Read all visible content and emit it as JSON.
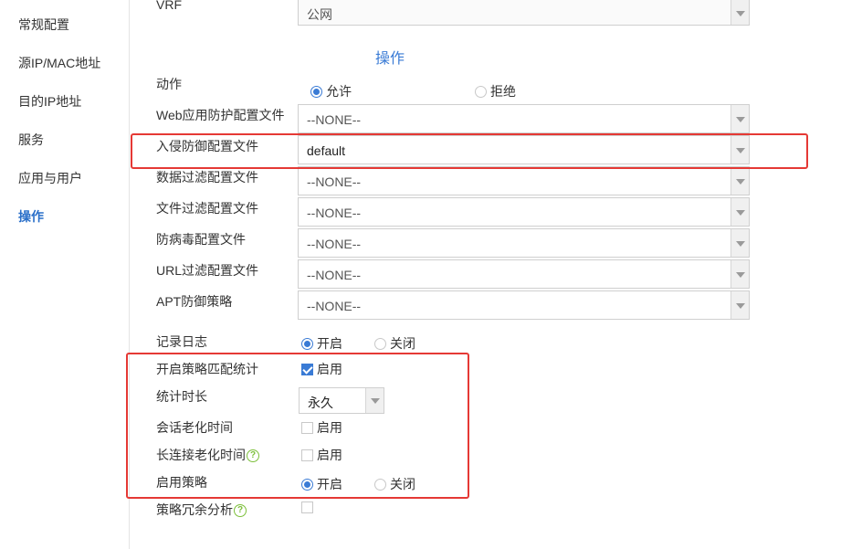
{
  "sidebar": {
    "items": [
      {
        "label": "常规配置"
      },
      {
        "label": "源IP/MAC地址"
      },
      {
        "label": "目的IP地址"
      },
      {
        "label": "服务"
      },
      {
        "label": "应用与用户"
      },
      {
        "label": "操作"
      }
    ],
    "active": "操作"
  },
  "vrf": {
    "label": "VRF",
    "value": "公网"
  },
  "section": {
    "title": "操作"
  },
  "action": {
    "label": "动作",
    "options": [
      "允许",
      "拒绝"
    ],
    "selected": "允许"
  },
  "profiles": [
    {
      "label": "Web应用防护配置文件",
      "value": "--NONE--"
    },
    {
      "label": "入侵防御配置文件",
      "value": "default"
    },
    {
      "label": "数据过滤配置文件",
      "value": "--NONE--"
    },
    {
      "label": "文件过滤配置文件",
      "value": "--NONE--"
    },
    {
      "label": "防病毒配置文件",
      "value": "--NONE--"
    },
    {
      "label": "URL过滤配置文件",
      "value": "--NONE--"
    },
    {
      "label": "APT防御策略",
      "value": "--NONE--"
    }
  ],
  "log": {
    "label": "记录日志",
    "options": [
      "开启",
      "关闭"
    ],
    "selected": "开启"
  },
  "match_stats": {
    "label": "开启策略匹配统计",
    "check_label": "启用",
    "checked": true
  },
  "stats_duration": {
    "label": "统计时长",
    "value": "永久"
  },
  "session_aging": {
    "label": "会话老化时间",
    "check_label": "启用",
    "checked": false
  },
  "long_conn_aging": {
    "label": "长连接老化时间",
    "check_label": "启用",
    "checked": false
  },
  "enable_policy": {
    "label": "启用策略",
    "options": [
      "开启",
      "关闭"
    ],
    "selected": "开启"
  },
  "redundancy": {
    "label": "策略冗余分析",
    "checked": false
  },
  "colors": {
    "accent": "#3a7bd5",
    "highlight": "#e53935",
    "help": "#7cbf3a"
  }
}
